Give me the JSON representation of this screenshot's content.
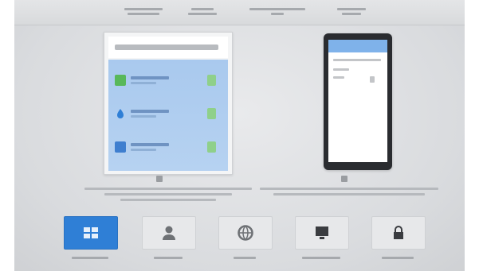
{
  "top_nav": {
    "items": [
      {
        "label": ""
      },
      {
        "label": ""
      },
      {
        "label": ""
      },
      {
        "label": ""
      }
    ]
  },
  "previews": {
    "left": {
      "header_text": "",
      "rows": [
        {
          "icon": "green-app-icon",
          "title": "",
          "subtitle": ""
        },
        {
          "icon": "blue-drop-icon",
          "title": "",
          "subtitle": ""
        },
        {
          "icon": "blue-app-icon",
          "title": "",
          "subtitle": ""
        }
      ],
      "caption": ""
    },
    "right": {
      "caption": ""
    }
  },
  "modes": [
    {
      "label": "",
      "icon": "windows-icon",
      "active": true
    },
    {
      "label": "",
      "icon": "person-icon",
      "active": false
    },
    {
      "label": "",
      "icon": "globe-icon",
      "active": false
    },
    {
      "label": "",
      "icon": "monitor-icon",
      "active": false
    },
    {
      "label": "",
      "icon": "lock-icon",
      "active": false
    }
  ],
  "colors": {
    "accent": "#2f7fd6",
    "toggle_on": "#8fd08a",
    "preview_blue": "#a9c9ee"
  }
}
